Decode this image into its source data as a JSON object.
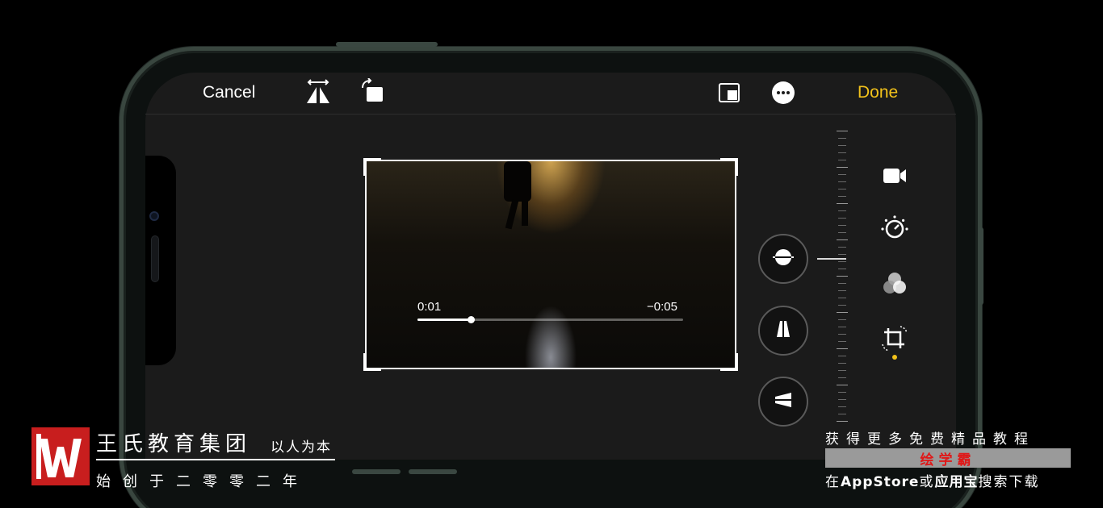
{
  "toolbar": {
    "cancel_label": "Cancel",
    "done_label": "Done",
    "icons": [
      "flip-horizontal-icon",
      "rotate-icon",
      "aspect-ratio-icon",
      "more-icon"
    ],
    "accent_color": "#f2c21b"
  },
  "video": {
    "elapsed": "0:01",
    "remaining": "−0:05",
    "progress_fraction": 0.2
  },
  "adjust_buttons": [
    "straighten-icon",
    "vertical-perspective-icon",
    "horizontal-perspective-icon"
  ],
  "side_tools": [
    "video-icon",
    "adjust-dial-icon",
    "filters-icon",
    "crop-rotate-icon"
  ],
  "watermark": {
    "brand_name": "王氏教育集团",
    "slogan": "以人为本",
    "since": "始创于二零零二年",
    "promo_top": "获得更多免费精品教程",
    "promo_app": "绘学霸",
    "promo_bottom_prefix": "在",
    "promo_bottom_store": "AppStore",
    "promo_bottom_or": "或",
    "promo_bottom_store2": "应用宝",
    "promo_bottom_suffix": "搜索下载",
    "brand_color": "#c81e1e"
  }
}
